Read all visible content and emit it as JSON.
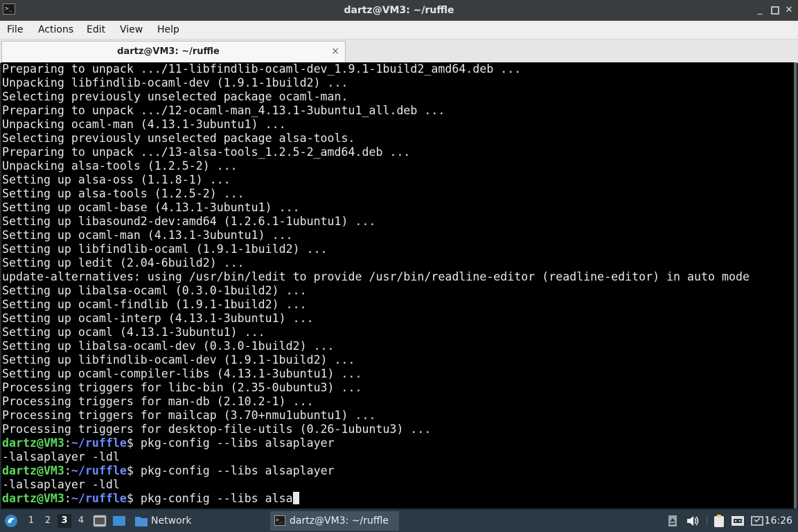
{
  "window": {
    "title": "dartz@VM3: ~/ruffle",
    "app_icon": "terminal-icon",
    "controls": [
      "minimize-icon",
      "maximize-icon",
      "close-icon"
    ]
  },
  "menubar": {
    "items": [
      "File",
      "Actions",
      "Edit",
      "View",
      "Help"
    ]
  },
  "tabs": [
    {
      "label": "dartz@VM3: ~/ruffle",
      "close": "×"
    }
  ],
  "terminal": {
    "output": [
      "Preparing to unpack .../11-libfindlib-ocaml-dev_1.9.1-1build2_amd64.deb ...",
      "Unpacking libfindlib-ocaml-dev (1.9.1-1build2) ...",
      "Selecting previously unselected package ocaml-man.",
      "Preparing to unpack .../12-ocaml-man_4.13.1-3ubuntu1_all.deb ...",
      "Unpacking ocaml-man (4.13.1-3ubuntu1) ...",
      "Selecting previously unselected package alsa-tools.",
      "Preparing to unpack .../13-alsa-tools_1.2.5-2_amd64.deb ...",
      "Unpacking alsa-tools (1.2.5-2) ...",
      "Setting up alsa-oss (1.1.8-1) ...",
      "Setting up alsa-tools (1.2.5-2) ...",
      "Setting up ocaml-base (4.13.1-3ubuntu1) ...",
      "Setting up libasound2-dev:amd64 (1.2.6.1-1ubuntu1) ...",
      "Setting up ocaml-man (4.13.1-3ubuntu1) ...",
      "Setting up libfindlib-ocaml (1.9.1-1build2) ...",
      "Setting up ledit (2.04-6build2) ...",
      "update-alternatives: using /usr/bin/ledit to provide /usr/bin/readline-editor (readline-editor) in auto mode",
      "Setting up libalsa-ocaml (0.3.0-1build2) ...",
      "Setting up ocaml-findlib (1.9.1-1build2) ...",
      "Setting up ocaml-interp (4.13.1-3ubuntu1) ...",
      "Setting up ocaml (4.13.1-3ubuntu1) ...",
      "Setting up libalsa-ocaml-dev (0.3.0-1build2) ...",
      "Setting up libfindlib-ocaml-dev (1.9.1-1build2) ...",
      "Setting up ocaml-compiler-libs (4.13.1-3ubuntu1) ...",
      "Processing triggers for libc-bin (2.35-0ubuntu3) ...",
      "Processing triggers for man-db (2.10.2-1) ...",
      "Processing triggers for mailcap (3.70+nmu1ubuntu1) ...",
      "Processing triggers for desktop-file-utils (0.26-1ubuntu3) ..."
    ],
    "prompt": {
      "user": "dartz@VM3",
      "colon": ":",
      "path": "~/ruffle",
      "symbol": "$"
    },
    "session": [
      {
        "command": " pkg-config --libs alsaplayer",
        "result": "-lalsaplayer -ldl"
      },
      {
        "command": " pkg-config --libs alsaplayer",
        "result": "-lalsaplayer -ldl"
      }
    ],
    "current_command": " pkg-config --libs alsa"
  },
  "taskbar": {
    "start_icon": "start-menu-icon",
    "workspaces": [
      "1",
      "2",
      "3",
      "4"
    ],
    "active_workspace": "3",
    "launchers": [
      "terminal-launcher-icon",
      "show-desktop-icon"
    ],
    "network_task": "Network",
    "terminal_task": "dartz@VM3: ~/ruffle",
    "tray_icons": [
      "eject-icon",
      "volume-icon",
      "clipboard-icon",
      "network-icon",
      "notifications-icon"
    ],
    "clock": "16:26"
  },
  "colors": {
    "prompt_user": "#5fd75f",
    "prompt_path": "#6c8cff",
    "terminal_bg": "#000000",
    "taskbar_bg": "#2b3944"
  }
}
